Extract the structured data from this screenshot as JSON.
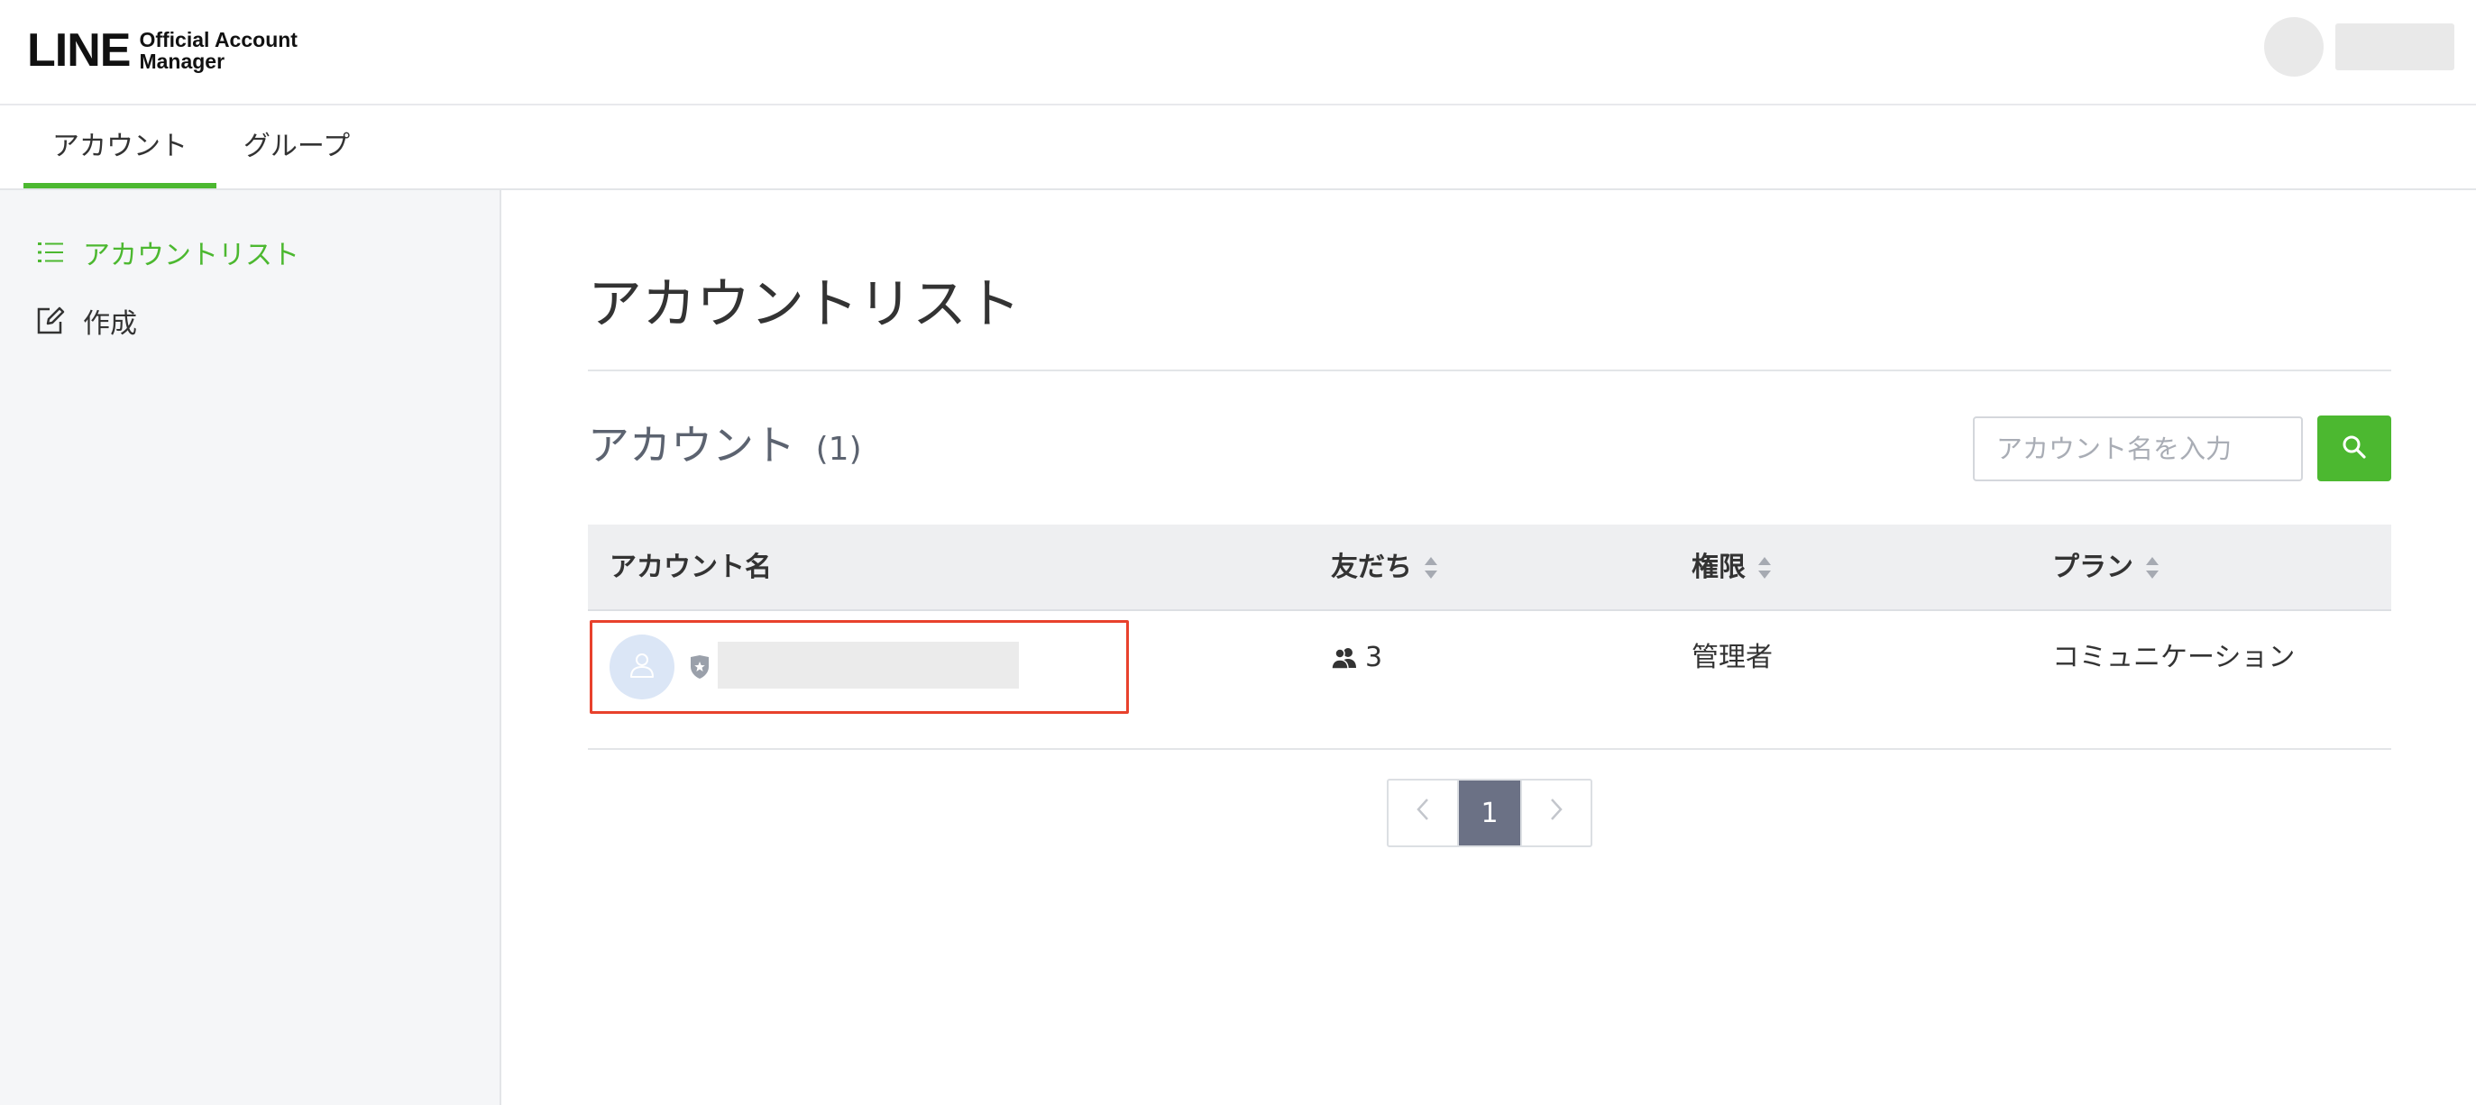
{
  "brand": {
    "logo_main": "LINE",
    "logo_sub_line1": "Official Account",
    "logo_sub_line2": "Manager"
  },
  "top_tabs": [
    {
      "label": "アカウント",
      "active": true
    },
    {
      "label": "グループ",
      "active": false
    }
  ],
  "sidebar": {
    "items": [
      {
        "label": "アカウントリスト",
        "icon": "list-icon",
        "active": true
      },
      {
        "label": "作成",
        "icon": "edit-icon",
        "active": false
      }
    ]
  },
  "main": {
    "page_title": "アカウントリスト",
    "section_title": "アカウント",
    "section_count": "(1)",
    "search": {
      "placeholder": "アカウント名を入力",
      "value": ""
    }
  },
  "table": {
    "columns": [
      {
        "label": "アカウント名",
        "sortable": false
      },
      {
        "label": "友だち",
        "sortable": true
      },
      {
        "label": "権限",
        "sortable": true
      },
      {
        "label": "プラン",
        "sortable": true
      }
    ],
    "rows": [
      {
        "name": "",
        "friends": "3",
        "role": "管理者",
        "plan": "コミュニケーション"
      }
    ]
  },
  "pagination": {
    "current_page": "1"
  },
  "colors": {
    "brand_green": "#4cb830",
    "highlight_red": "#e8412c",
    "pager_active": "#6b7185"
  }
}
